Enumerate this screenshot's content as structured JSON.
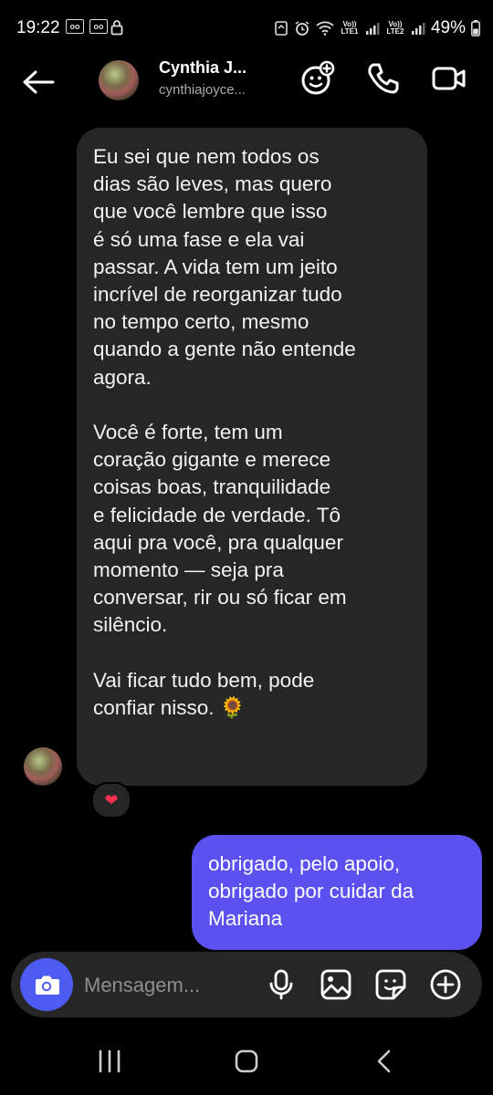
{
  "status_bar": {
    "time": "19:22",
    "battery": "49%",
    "sim1": "Vo)) LTE1",
    "sim2": "Vo)) LTE2"
  },
  "header": {
    "contact_name": "Cynthia J...",
    "contact_handle": "cynthiajoyce..."
  },
  "messages": {
    "incoming_text": "Eu sei que nem todos os\ndias são leves, mas quero\nque você lembre que isso\né só uma fase e ela vai\npassar. A vida tem um jeito\nincrível de reorganizar tudo\nno tempo certo, mesmo\nquando a gente não entende\nagora.\n\nVocê é forte, tem um\ncoração gigante e merece\ncoisas boas, tranquilidade\ne felicidade de verdade. Tô\naqui pra você, pra qualquer\nmomento — seja pra\nconversar, rir ou só ficar em\nsilêncio.\n\nVai ficar tudo bem, pode\nconfiar nisso. 🌻",
    "reaction": "❤",
    "outgoing_text": "obrigado, pelo apoio, obrigado por cuidar da Mariana"
  },
  "composer": {
    "placeholder": "Mensagem..."
  },
  "colors": {
    "incoming_bubble": "#262626",
    "outgoing_bubble": "#5b51f0",
    "camera_button": "#4c5bf2",
    "background": "#000000"
  }
}
